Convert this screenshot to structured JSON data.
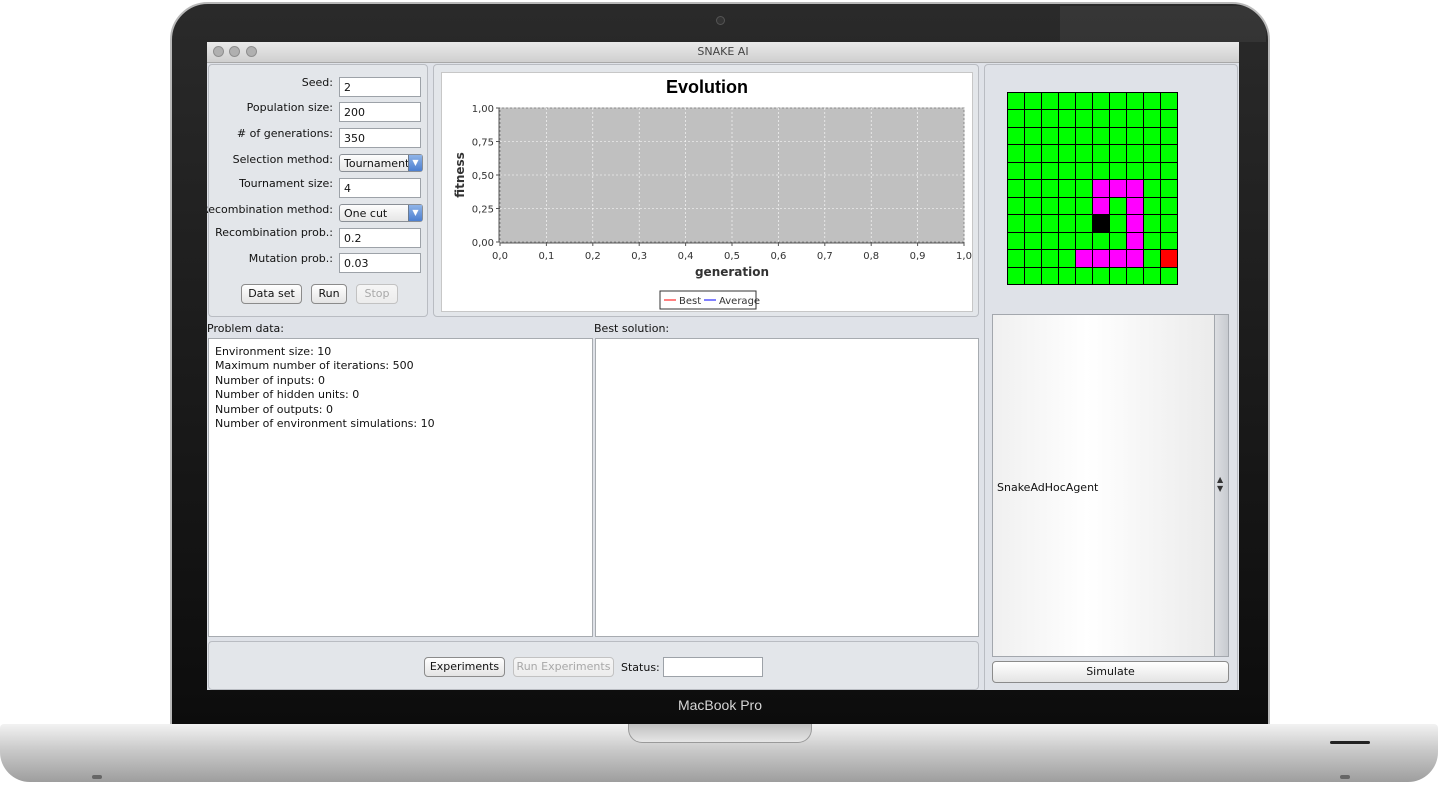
{
  "device": {
    "brand": "MacBook Pro"
  },
  "window": {
    "title": "SNAKE AI"
  },
  "params": {
    "seed": {
      "label": "Seed:",
      "value": "2"
    },
    "population": {
      "label": "Population size:",
      "value": "200"
    },
    "generations": {
      "label": "# of generations:",
      "value": "350"
    },
    "selection": {
      "label": "Selection method:",
      "value": "Tournament"
    },
    "tournament": {
      "label": "Tournament size:",
      "value": "4"
    },
    "recombination": {
      "label": "Recombination method:",
      "value": "One cut"
    },
    "recomb_prob": {
      "label": "Recombination prob.:",
      "value": "0.2"
    },
    "mutation_prob": {
      "label": "Mutation prob.:",
      "value": "0.03"
    }
  },
  "buttons": {
    "dataset": "Data set",
    "run": "Run",
    "stop": "Stop",
    "experiments": "Experiments",
    "run_experiments": "Run Experiments",
    "simulate": "Simulate"
  },
  "status": {
    "label": "Status:",
    "value": ""
  },
  "chart_data": {
    "type": "line",
    "title": "Evolution",
    "xlabel": "generation",
    "ylabel": "fitness",
    "xlim": [
      0,
      1.0
    ],
    "ylim": [
      0,
      1.0
    ],
    "xticks": [
      "0,0",
      "0,1",
      "0,2",
      "0,3",
      "0,4",
      "0,5",
      "0,6",
      "0,7",
      "0,8",
      "0,9",
      "1,0"
    ],
    "yticks": [
      "0,00",
      "0,25",
      "0,50",
      "0,75",
      "1,00"
    ],
    "grid": true,
    "legend_position": "bottom",
    "series": [
      {
        "name": "Best",
        "color": "#ff0000",
        "values": []
      },
      {
        "name": "Average",
        "color": "#0000ff",
        "values": []
      }
    ]
  },
  "problem": {
    "label": "Problem data:",
    "lines": [
      "Environment size: 10",
      "Maximum number of iterations: 500",
      "Number of inputs: 0",
      "Number of hidden units: 0",
      "Number of outputs: 0",
      "Number of environment simulations: 10"
    ]
  },
  "solution": {
    "label": "Best solution:"
  },
  "agent": {
    "selected": "SnakeAdHocAgent"
  },
  "board": {
    "cols": 10,
    "rows": 11,
    "colors": {
      "empty": "#00ff00",
      "body": "#ff00ff",
      "head": "#000000",
      "food": "#ff0000"
    },
    "cells": [
      "..........",
      "..........",
      "..........",
      "..........",
      "..........",
      ".....BBB..",
      ".....B.B..",
      ".....H.B..",
      ".......B..",
      "....BBBB.F",
      ".........."
    ]
  }
}
